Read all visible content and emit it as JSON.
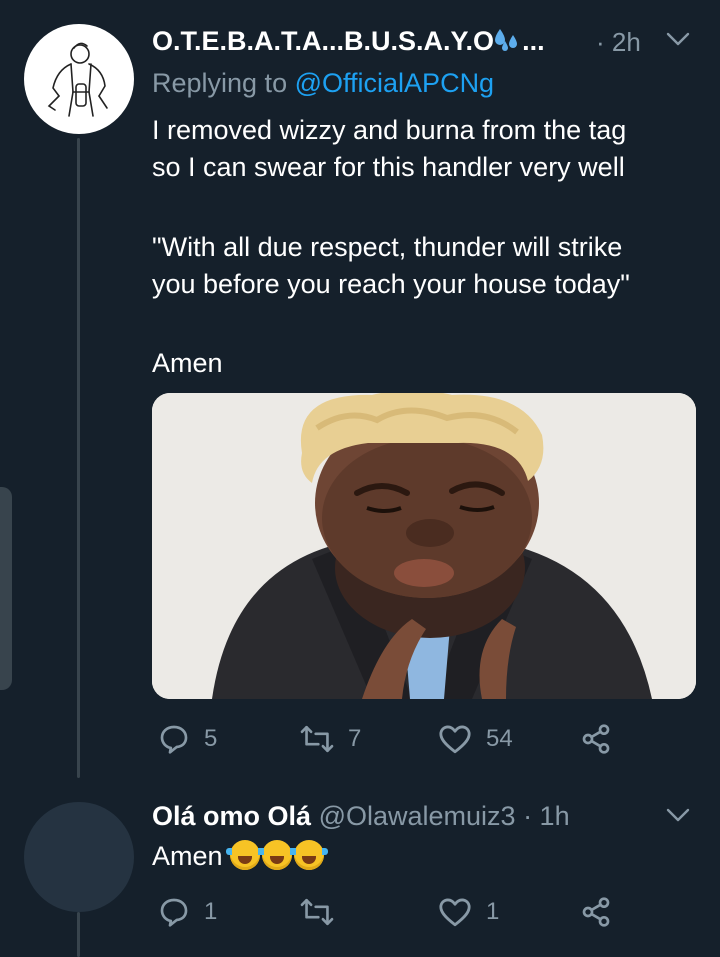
{
  "tweet1": {
    "display_name": "O.T.E.B.A.T.A...B.U.S.A.Y.O",
    "name_suffix": "...",
    "time": "· 2h",
    "replying_prefix": "Replying to",
    "replying_handle": "@OfficialAPCNg",
    "lines": [
      "I removed wizzy and burna from the tag",
      "so I can swear for this handler very well",
      "\"With all due respect, thunder will strike",
      "you before you reach your house today\"",
      "Amen"
    ],
    "actions": {
      "replies": "5",
      "retweets": "7",
      "likes": "54"
    }
  },
  "tweet2": {
    "display_name": "Olá omo Olá",
    "handle": "@Olawalemuiz3",
    "time": "· 1h",
    "text": "Amen",
    "emoji_count": 3,
    "actions": {
      "replies": "1",
      "retweets": "",
      "likes": "1"
    }
  },
  "icons": {
    "chevron": "chevron-down-icon",
    "reply": "reply-icon",
    "retweet": "retweet-icon",
    "like": "heart-icon",
    "share": "share-icon"
  },
  "colors": {
    "background": "#15202b",
    "muted": "#8899a6",
    "link": "#1da1f2",
    "line": "#38444d"
  }
}
